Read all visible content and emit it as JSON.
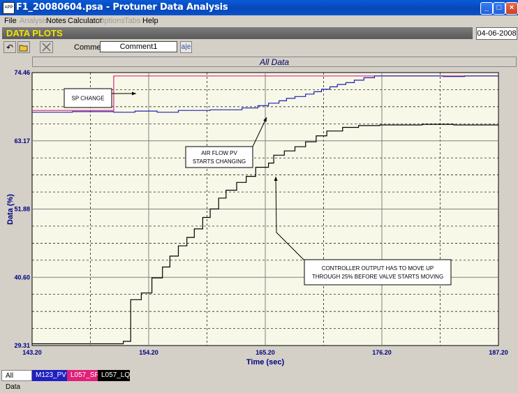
{
  "window": {
    "title": "F1_20080604.psa - Protuner Data  Analysis",
    "app_icon": "APP",
    "buttons": {
      "minimize": "_",
      "maximize": "□",
      "close": "×"
    }
  },
  "menu": [
    {
      "label": "File",
      "enabled": true
    },
    {
      "label": "Analysis",
      "enabled": false
    },
    {
      "label": "Notes",
      "enabled": true
    },
    {
      "label": "Calculator",
      "enabled": true
    },
    {
      "label": "Options",
      "enabled": false
    },
    {
      "label": "Tabs",
      "enabled": false
    },
    {
      "label": "Help",
      "enabled": true
    }
  ],
  "banner": {
    "label": "DATA PLOTS",
    "date": "04-06-2008"
  },
  "toolbar": {
    "undo_icon": "undo-icon",
    "open_icon": "open-folder-icon",
    "clear_icon": "clear-icon",
    "comment_label": "Comment",
    "comment_value": "Comment1",
    "ab_label": "a|e"
  },
  "colors": {
    "sp": "#e0207a",
    "pv": "#2020b0",
    "lq": "#000000",
    "plot_bg": "#f8f8e8",
    "banner_text": "#f3e400"
  },
  "chart_data": {
    "type": "line",
    "title": "All Data",
    "xlabel": "Time (sec)",
    "ylabel": "Data (%)",
    "xlim": [
      143.2,
      187.2
    ],
    "ylim": [
      29.31,
      74.46
    ],
    "x_ticks": [
      "143.20",
      "154.20",
      "165.20",
      "176.20",
      "187.20"
    ],
    "y_ticks": [
      "29.31",
      "40.60",
      "51.88",
      "63.17",
      "74.46"
    ],
    "grid": true,
    "series": [
      {
        "name": "L057_SP",
        "values": [
          [
            143.2,
            68.2
          ],
          [
            150.8,
            68.2
          ],
          [
            150.8,
            68.2
          ],
          [
            150.9,
            68.2
          ],
          [
            150.9,
            73.9
          ],
          [
            187.2,
            73.9
          ]
        ]
      },
      {
        "name": "M123_PV",
        "values": [
          [
            143.2,
            67.9
          ],
          [
            147,
            67.9
          ],
          [
            147,
            68.0
          ],
          [
            150.9,
            68.0
          ],
          [
            150.9,
            67.9
          ],
          [
            152.9,
            67.9
          ],
          [
            152.9,
            68.1
          ],
          [
            155,
            68.1
          ],
          [
            155,
            67.9
          ],
          [
            157,
            67.9
          ],
          [
            157,
            68.2
          ],
          [
            160,
            68.2
          ],
          [
            160,
            68.3
          ],
          [
            163,
            68.3
          ],
          [
            163,
            68.6
          ],
          [
            164.5,
            68.6
          ],
          [
            164.5,
            69.0
          ],
          [
            165.5,
            69.0
          ],
          [
            165.5,
            69.4
          ],
          [
            166.5,
            69.4
          ],
          [
            166.5,
            69.8
          ],
          [
            167.2,
            69.8
          ],
          [
            167.2,
            70.2
          ],
          [
            168,
            70.2
          ],
          [
            168,
            70.5
          ],
          [
            169,
            70.5
          ],
          [
            169,
            70.9
          ],
          [
            169.8,
            70.9
          ],
          [
            169.8,
            71.3
          ],
          [
            170.5,
            71.3
          ],
          [
            170.5,
            71.7
          ],
          [
            171.3,
            71.7
          ],
          [
            171.3,
            72.1
          ],
          [
            172,
            72.1
          ],
          [
            172,
            72.5
          ],
          [
            172.8,
            72.5
          ],
          [
            172.8,
            72.8
          ],
          [
            173.6,
            72.8
          ],
          [
            173.6,
            73.2
          ],
          [
            174.5,
            73.2
          ],
          [
            174.5,
            73.6
          ],
          [
            175.5,
            73.6
          ],
          [
            175.5,
            73.9
          ],
          [
            182,
            73.9
          ],
          [
            182,
            73.8
          ],
          [
            184,
            73.8
          ],
          [
            184,
            73.9
          ],
          [
            187.2,
            73.9
          ]
        ]
      },
      {
        "name": "L057_LQ",
        "values": [
          [
            143.2,
            29.6
          ],
          [
            151.8,
            29.6
          ],
          [
            151.8,
            30.0
          ],
          [
            152.5,
            30.0
          ],
          [
            152.5,
            36.9
          ],
          [
            153.5,
            36.9
          ],
          [
            153.5,
            38.0
          ],
          [
            154.5,
            38.0
          ],
          [
            154.5,
            40.5
          ],
          [
            155.5,
            40.5
          ],
          [
            155.5,
            42.3
          ],
          [
            156.2,
            42.3
          ],
          [
            156.2,
            44.1
          ],
          [
            157,
            44.1
          ],
          [
            157,
            45.8
          ],
          [
            157.8,
            45.8
          ],
          [
            157.8,
            47.2
          ],
          [
            158.5,
            47.2
          ],
          [
            158.5,
            48.6
          ],
          [
            159.3,
            48.6
          ],
          [
            159.3,
            50.5
          ],
          [
            160,
            50.5
          ],
          [
            160,
            51.9
          ],
          [
            160.8,
            51.9
          ],
          [
            160.8,
            53.7
          ],
          [
            161.5,
            53.7
          ],
          [
            161.5,
            55.0
          ],
          [
            162.5,
            55.0
          ],
          [
            162.5,
            56.3
          ],
          [
            163.4,
            56.3
          ],
          [
            163.4,
            57.3
          ],
          [
            164.3,
            57.3
          ],
          [
            164.3,
            58.8
          ],
          [
            165.5,
            58.8
          ],
          [
            165.5,
            59.5
          ],
          [
            166,
            59.5
          ],
          [
            166,
            60.8
          ],
          [
            167,
            60.8
          ],
          [
            167,
            61.5
          ],
          [
            168,
            61.5
          ],
          [
            168,
            62.2
          ],
          [
            169,
            62.2
          ],
          [
            169,
            63.0
          ],
          [
            170,
            63.0
          ],
          [
            170,
            64.0
          ],
          [
            171,
            64.0
          ],
          [
            171,
            64.8
          ],
          [
            172.5,
            64.8
          ],
          [
            172.5,
            65.4
          ],
          [
            174,
            65.4
          ],
          [
            174,
            65.7
          ],
          [
            176,
            65.7
          ],
          [
            176,
            65.8
          ],
          [
            180,
            65.8
          ],
          [
            180,
            65.9
          ],
          [
            183,
            65.9
          ],
          [
            183,
            65.8
          ],
          [
            187.2,
            65.8
          ]
        ]
      }
    ],
    "annotations": [
      {
        "id": "sp-change",
        "lines": [
          "SP CHANGE"
        ]
      },
      {
        "id": "air-flow",
        "lines": [
          "AIR FLOW PV",
          "STARTS CHANGING"
        ]
      },
      {
        "id": "controller-output",
        "lines": [
          "CONTROLLER OUTPUT HAS TO MOVE UP",
          "THROUGH 25% BEFORE VALVE STARTS MOVING"
        ]
      }
    ]
  },
  "tabs": [
    {
      "label": "All Data",
      "active": true,
      "bg": "#ffffff",
      "fg": "#000000"
    },
    {
      "label": "M123_PV",
      "active": false,
      "bg": "#2020c0",
      "fg": "#ffffff"
    },
    {
      "label": "L057_SP",
      "active": false,
      "bg": "#e0207a",
      "fg": "#ffffff"
    },
    {
      "label": "L057_LQ",
      "active": false,
      "bg": "#000000",
      "fg": "#ffffff"
    }
  ]
}
